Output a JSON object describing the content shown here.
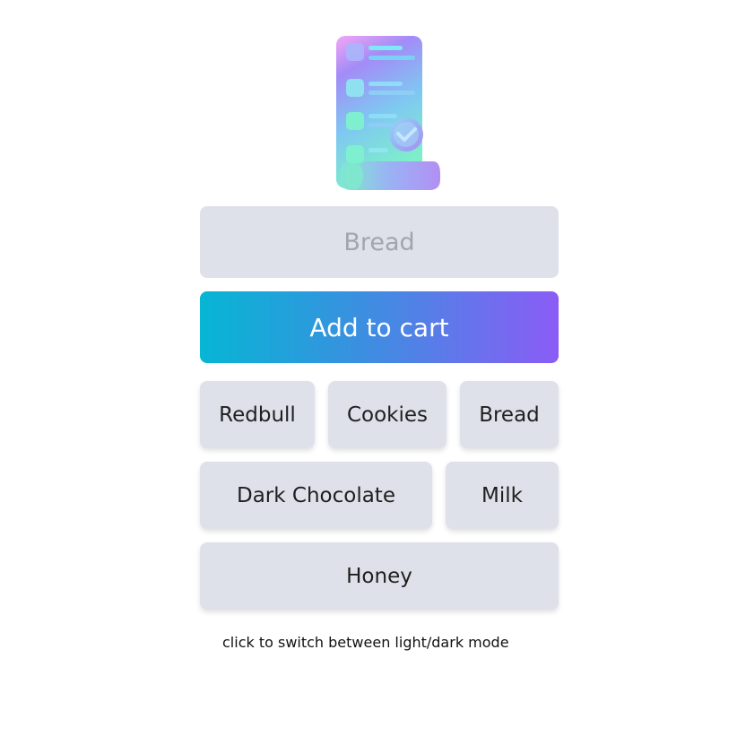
{
  "app": {
    "logo_icon": "shopping-list-scroll-icon"
  },
  "input": {
    "placeholder": "Bread",
    "value": ""
  },
  "add_button": {
    "label": "Add to cart"
  },
  "items": [
    {
      "label": "Redbull"
    },
    {
      "label": "Cookies"
    },
    {
      "label": "Bread"
    },
    {
      "label": "Dark Chocolate"
    },
    {
      "label": "Milk"
    },
    {
      "label": "Honey"
    }
  ],
  "footer": {
    "mode_toggle_label": "click to switch between light/dark mode"
  },
  "colors": {
    "gradient_start": "#06b6d4",
    "gradient_end": "#8b5cf6",
    "chip_background": "#dee1ea"
  }
}
